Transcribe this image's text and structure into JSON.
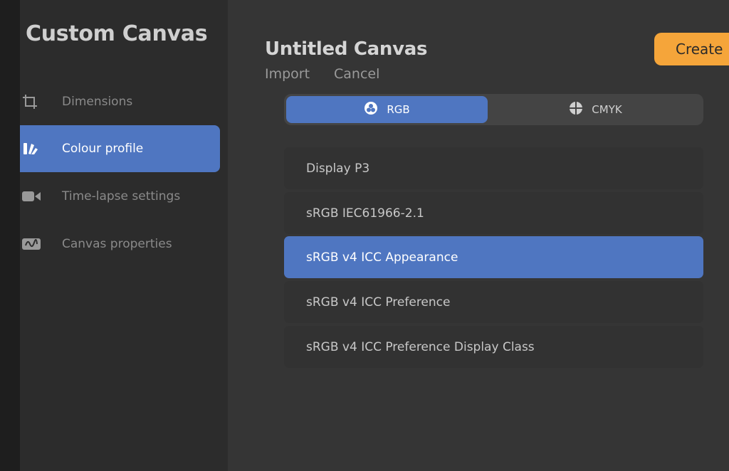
{
  "sidebar": {
    "title": "Custom Canvas",
    "items": [
      {
        "label": "Dimensions",
        "icon": "crop-icon",
        "active": false
      },
      {
        "label": "Colour profile",
        "icon": "colour-swatch-icon",
        "active": true
      },
      {
        "label": "Time-lapse settings",
        "icon": "video-camera-icon",
        "active": false
      },
      {
        "label": "Canvas properties",
        "icon": "canvas-properties-icon",
        "active": false
      }
    ]
  },
  "header": {
    "title": "Untitled Canvas",
    "import_label": "Import",
    "cancel_label": "Cancel",
    "create_label": "Create"
  },
  "colour_modes": [
    {
      "label": "RGB",
      "icon": "rgb-icon",
      "active": true
    },
    {
      "label": "CMYK",
      "icon": "cmyk-icon",
      "active": false
    }
  ],
  "profiles": [
    {
      "label": "Display P3",
      "selected": false
    },
    {
      "label": "sRGB IEC61966-2.1",
      "selected": false
    },
    {
      "label": "sRGB v4 ICC Appearance",
      "selected": true
    },
    {
      "label": "sRGB v4 ICC Preference",
      "selected": false
    },
    {
      "label": "sRGB v4 ICC Preference Display Class",
      "selected": false
    }
  ],
  "colors": {
    "accent": "#4f76c1",
    "create_button": "#f5a53a",
    "background": "#353535",
    "sidebar": "#2c2c2c"
  }
}
